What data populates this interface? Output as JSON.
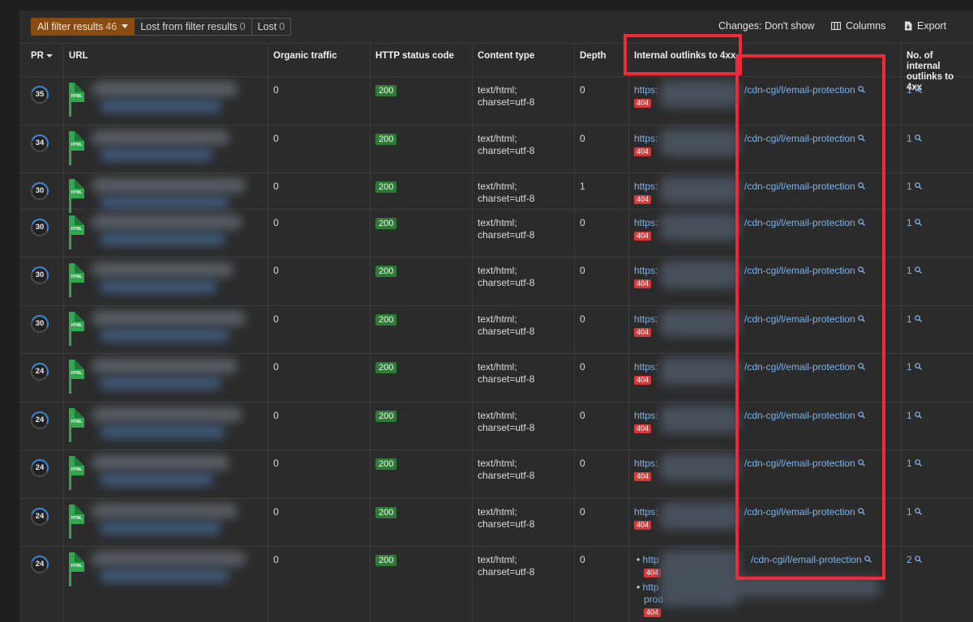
{
  "toolbar": {
    "filters": [
      {
        "label": "All filter results",
        "count": "46"
      },
      {
        "label": "Lost from filter results",
        "count": "0"
      },
      {
        "label": "Lost",
        "count": "0"
      }
    ],
    "changes_label": "Changes: Don't show",
    "columns_label": "Columns",
    "export_label": "Export"
  },
  "table": {
    "headers": {
      "pr": "PR",
      "url": "URL",
      "organic_traffic": "Organic traffic",
      "http_status": "HTTP status code",
      "content_type": "Content type",
      "depth": "Depth",
      "internal_outlinks_4xx": "Internal outlinks to 4xx",
      "num_internal_outlinks_4xx_line1": "No. of internal",
      "num_internal_outlinks_4xx_line2": "outlinks to 4xx"
    },
    "html_icon_label": "HTML",
    "rows": [
      {
        "pr": "35",
        "organic": "0",
        "status": "200",
        "ctype1": "text/html;",
        "ctype2": "charset=utf-8",
        "depth": "0",
        "link_prefix": "https:",
        "link_suffix": "/cdn-cgi/l/email-protection",
        "badge": "404",
        "count": "1"
      },
      {
        "pr": "34",
        "organic": "0",
        "status": "200",
        "ctype1": "text/html;",
        "ctype2": "charset=utf-8",
        "depth": "0",
        "link_prefix": "https:",
        "link_suffix": "/cdn-cgi/l/email-protection",
        "badge": "404",
        "count": "1"
      },
      {
        "pr": "30",
        "organic": "0",
        "status": "200",
        "ctype1": "text/html;",
        "ctype2": "charset=utf-8",
        "depth": "1",
        "link_prefix": "https:",
        "link_suffix": "/cdn-cgi/l/email-protection",
        "badge": "404",
        "count": "1"
      },
      {
        "pr": "30",
        "organic": "0",
        "status": "200",
        "ctype1": "text/html;",
        "ctype2": "charset=utf-8",
        "depth": "0",
        "link_prefix": "https:",
        "link_suffix": "/cdn-cgi/l/email-protection",
        "badge": "404",
        "count": "1"
      },
      {
        "pr": "30",
        "organic": "0",
        "status": "200",
        "ctype1": "text/html;",
        "ctype2": "charset=utf-8",
        "depth": "0",
        "link_prefix": "https:",
        "link_suffix": "/cdn-cgi/l/email-protection",
        "badge": "404",
        "count": "1"
      },
      {
        "pr": "30",
        "organic": "0",
        "status": "200",
        "ctype1": "text/html;",
        "ctype2": "charset=utf-8",
        "depth": "0",
        "link_prefix": "https:",
        "link_suffix": "/cdn-cgi/l/email-protection",
        "badge": "404",
        "count": "1"
      },
      {
        "pr": "24",
        "organic": "0",
        "status": "200",
        "ctype1": "text/html;",
        "ctype2": "charset=utf-8",
        "depth": "0",
        "link_prefix": "https:",
        "link_suffix": "/cdn-cgi/l/email-protection",
        "badge": "404",
        "count": "1"
      },
      {
        "pr": "24",
        "organic": "0",
        "status": "200",
        "ctype1": "text/html;",
        "ctype2": "charset=utf-8",
        "depth": "0",
        "link_prefix": "https:",
        "link_suffix": "/cdn-cgi/l/email-protection",
        "badge": "404",
        "count": "1"
      },
      {
        "pr": "24",
        "organic": "0",
        "status": "200",
        "ctype1": "text/html;",
        "ctype2": "charset=utf-8",
        "depth": "0",
        "link_prefix": "https:",
        "link_suffix": "/cdn-cgi/l/email-protection",
        "badge": "404",
        "count": "1"
      },
      {
        "pr": "24",
        "organic": "0",
        "status": "200",
        "ctype1": "text/html;",
        "ctype2": "charset=utf-8",
        "depth": "0",
        "link_prefix": "https:",
        "link_suffix": "/cdn-cgi/l/email-protection",
        "badge": "404",
        "count": "1"
      },
      {
        "pr": "24",
        "organic": "0",
        "status": "200",
        "ctype1": "text/html;",
        "ctype2": "charset=utf-8",
        "depth": "0",
        "link_prefix": "http",
        "link_suffix": "/cdn-cgi/l/email-protection",
        "badge": "404",
        "count": "2",
        "second_link_prefix": "http",
        "second_link_line2": "prod",
        "second_badge": "404"
      }
    ]
  },
  "colors": {
    "accent_filter": "#8a4b11",
    "link": "#7cb4ec",
    "status_ok": "#2f7a36",
    "status_error": "#d63a3a",
    "highlight": "#ee2b3b"
  }
}
